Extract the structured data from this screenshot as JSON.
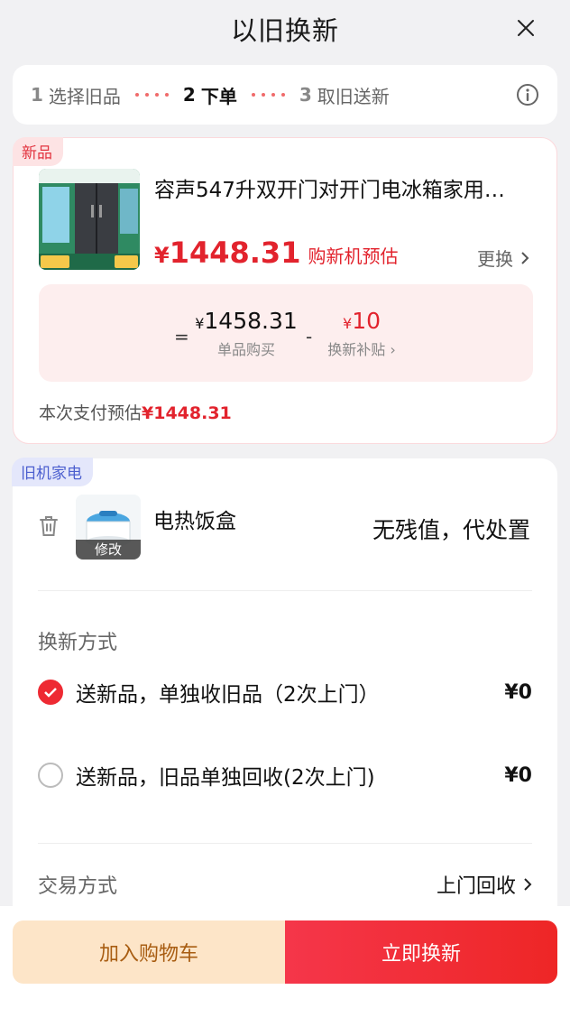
{
  "header": {
    "title": "以旧换新"
  },
  "steps": [
    {
      "num": "1",
      "label": "选择旧品"
    },
    {
      "num": "2",
      "label": "下单"
    },
    {
      "num": "3",
      "label": "取旧送新"
    }
  ],
  "new_item": {
    "tag": "新品",
    "title": "容声547升双开门对开门电冰箱家用…",
    "price_yen": "¥",
    "price": "1448.31",
    "price_note": "购新机预估",
    "change_label": "更换",
    "calc": {
      "equals": "=",
      "unit_yen": "¥",
      "unit_price": "1458.31",
      "unit_price_label": "单品购买",
      "minus": "-",
      "subsidy_yen": "¥",
      "subsidy": "10",
      "subsidy_label": "换新补贴 ›"
    },
    "pay_estimate_label": "本次支付预估",
    "pay_estimate_value": "¥1448.31"
  },
  "old_item": {
    "tag": "旧机家电",
    "name": "电热饭盒",
    "edit_label": "修改",
    "value_text": "无残值，代处置"
  },
  "exchange_method": {
    "label": "换新方式",
    "options": [
      {
        "label": "送新品，单独收旧品（2次上门）",
        "price": "¥0",
        "selected": true
      },
      {
        "label": "送新品，旧品单独回收(2次上门)",
        "price": "¥0",
        "selected": false
      }
    ]
  },
  "trade": {
    "label": "交易方式",
    "value": "上门回收"
  },
  "buttons": {
    "cart": "加入购物车",
    "buy": "立即换新"
  },
  "colors": {
    "accent_red": "#e2232d",
    "cart_bg": "#fde5c8",
    "cart_text": "#a85d12"
  }
}
